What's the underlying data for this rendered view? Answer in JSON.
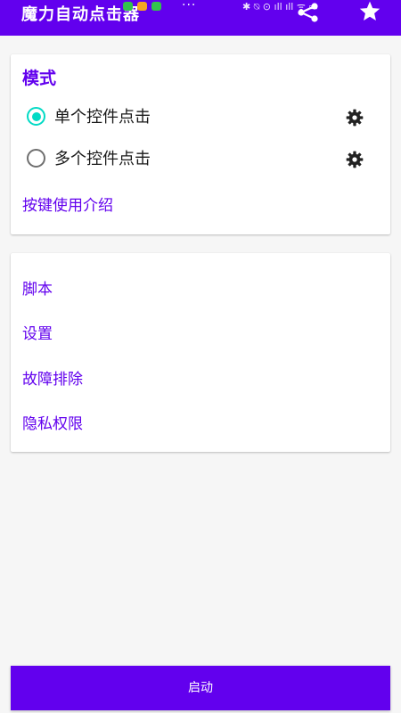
{
  "app": {
    "title": "魔力自动点击器"
  },
  "status_bar": {
    "more_indicator": "···",
    "system_icons": "✱ ⍉ ⊙ ıll ıll ᯤ ▭",
    "notification_colors": [
      "#33c24d",
      "#f5a623",
      "#33c24d"
    ]
  },
  "toolbar": {
    "share_icon": "share-icon",
    "star_icon": "star-icon"
  },
  "mode_card": {
    "title": "模式",
    "options": [
      {
        "label": "单个控件点击",
        "selected": true
      },
      {
        "label": "多个控件点击",
        "selected": false
      }
    ],
    "settings_icon": "gear-icon",
    "help_link": "按键使用介绍"
  },
  "menu": {
    "items": [
      {
        "label": "脚本"
      },
      {
        "label": "设置"
      },
      {
        "label": "故障排除"
      },
      {
        "label": "隐私权限"
      }
    ]
  },
  "footer": {
    "start_label": "启动"
  },
  "colors": {
    "primary": "#6200ee",
    "accent": "#03dac5",
    "background": "#f6f6f6",
    "card": "#ffffff"
  }
}
